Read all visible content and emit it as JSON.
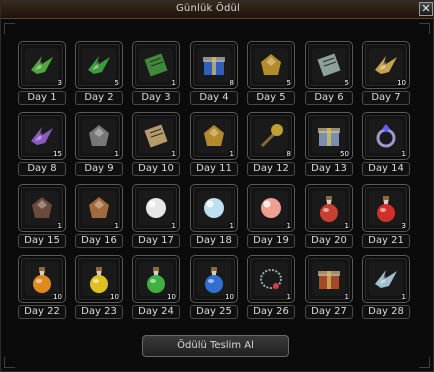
{
  "window": {
    "title": "Günlük Ödül",
    "close_label": "✕"
  },
  "claim_button_label": "Ödülü Teslim Al",
  "rewards": [
    {
      "day": "Day 1",
      "count": "3",
      "icon": "green-wings-icon",
      "color": "#4fa83a"
    },
    {
      "day": "Day 2",
      "count": "5",
      "icon": "green-wings-icon",
      "color": "#3c9c3a"
    },
    {
      "day": "Day 3",
      "count": "1",
      "icon": "green-scroll-icon",
      "color": "#3f8a3a"
    },
    {
      "day": "Day 4",
      "count": "8",
      "icon": "blue-box-icon",
      "color": "#2f5fb8"
    },
    {
      "day": "Day 5",
      "count": "5",
      "icon": "golden-horn-icon",
      "color": "#b58a2a"
    },
    {
      "day": "Day 6",
      "count": "5",
      "icon": "scroll-icon",
      "color": "#8aa29a"
    },
    {
      "day": "Day 7",
      "count": "10",
      "icon": "golden-wings-icon",
      "color": "#c9a24a"
    },
    {
      "day": "Day 8",
      "count": "15",
      "icon": "purple-wings-icon",
      "color": "#8a5ac0"
    },
    {
      "day": "Day 9",
      "count": "1",
      "icon": "stone-icon",
      "color": "#777777"
    },
    {
      "day": "Day 10",
      "count": "1",
      "icon": "parchment-icon",
      "color": "#b59a6a"
    },
    {
      "day": "Day 11",
      "count": "1",
      "icon": "ore-icon",
      "color": "#b38a2a"
    },
    {
      "day": "Day 12",
      "count": "8",
      "icon": "mace-icon",
      "color": "#c0a030"
    },
    {
      "day": "Day 13",
      "count": "50",
      "icon": "gift-box-icon",
      "color": "#7a8fb0"
    },
    {
      "day": "Day 14",
      "count": "1",
      "icon": "ring-icon",
      "color": "#9a9ad0"
    },
    {
      "day": "Day 15",
      "count": "1",
      "icon": "gauntlet-icon",
      "color": "#6a4a3a"
    },
    {
      "day": "Day 16",
      "count": "1",
      "icon": "bag-icon",
      "color": "#a06a3a"
    },
    {
      "day": "Day 17",
      "count": "1",
      "icon": "white-pearl-icon",
      "color": "#e6e6e6"
    },
    {
      "day": "Day 18",
      "count": "1",
      "icon": "blue-pearl-icon",
      "color": "#bfdff0"
    },
    {
      "day": "Day 19",
      "count": "1",
      "icon": "red-pearl-icon",
      "color": "#f0a090"
    },
    {
      "day": "Day 20",
      "count": "1",
      "icon": "red-blue-potion-icon",
      "color": "#c84030"
    },
    {
      "day": "Day 21",
      "count": "3",
      "icon": "red-potion-icon",
      "color": "#d0302a"
    },
    {
      "day": "Day 22",
      "count": "10",
      "icon": "orange-potion-icon",
      "color": "#e08a20"
    },
    {
      "day": "Day 23",
      "count": "10",
      "icon": "yellow-potion-icon",
      "color": "#e0c020"
    },
    {
      "day": "Day 24",
      "count": "10",
      "icon": "green-potion-icon",
      "color": "#40b040"
    },
    {
      "day": "Day 25",
      "count": "10",
      "icon": "blue-potion-icon",
      "color": "#3070d0"
    },
    {
      "day": "Day 26",
      "count": "1",
      "icon": "chain-necklace-icon",
      "color": "#8ab0c0"
    },
    {
      "day": "Day 27",
      "count": "1",
      "icon": "treasure-chest-icon",
      "color": "#a04a2a"
    },
    {
      "day": "Day 28",
      "count": "1",
      "icon": "silver-wings-icon",
      "color": "#a0c0d0"
    }
  ]
}
